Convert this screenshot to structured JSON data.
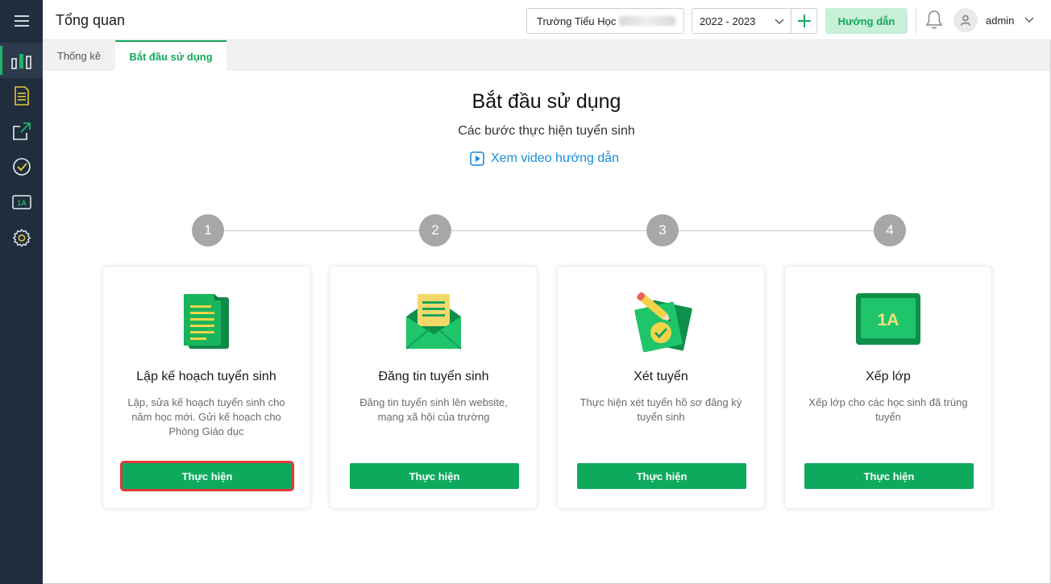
{
  "header": {
    "title": "Tổng quan",
    "school_name": "Trường Tiểu Học",
    "school_year": "2022 - 2023",
    "guide_label": "Hướng dẫn",
    "user_name": "admin"
  },
  "tabs": [
    {
      "label": "Thống kê"
    },
    {
      "label": "Bắt đầu sử dụng"
    }
  ],
  "main": {
    "title": "Bắt đầu sử dụng",
    "subtitle": "Các bước thực hiện tuyển sinh",
    "video_link": "Xem video hướng dẫn"
  },
  "steps": [
    {
      "number": "1",
      "title": "Lập kế hoạch tuyển sinh",
      "description": "Lập, sửa kế hoạch tuyển sinh cho năm học mới. Gửi kế hoạch cho Phòng Giáo dục",
      "button": "Thực hiện",
      "icon": "document-icon"
    },
    {
      "number": "2",
      "title": "Đăng tin tuyển sinh",
      "description": "Đăng tin tuyển sinh lên website, mạng xã hội của trường",
      "button": "Thực hiện",
      "icon": "envelope-icon"
    },
    {
      "number": "3",
      "title": "Xét tuyển",
      "description": "Thực hiện xét tuyển hồ sơ đăng ký tuyển sinh",
      "button": "Thực hiện",
      "icon": "checklist-pencil-icon"
    },
    {
      "number": "4",
      "title": "Xếp lớp",
      "description": "Xếp lớp cho các học sinh đã trúng tuyển",
      "button": "Thực hiện",
      "icon": "class-board-icon",
      "icon_text": "1A"
    }
  ],
  "sidebar": {
    "items": [
      {
        "icon": "menu-icon"
      },
      {
        "icon": "dashboard-chart-icon"
      },
      {
        "icon": "plan-document-icon"
      },
      {
        "icon": "post-arrow-icon"
      },
      {
        "icon": "check-circle-icon"
      },
      {
        "icon": "class-1a-icon",
        "label": "1A"
      },
      {
        "icon": "settings-gear-icon"
      }
    ]
  },
  "colors": {
    "sidebar_bg": "#1f2d3d",
    "accent_green": "#0daa5d",
    "guide_bg": "#c8efd8",
    "link_blue": "#1a8cd8",
    "highlight_red": "#e03a3a"
  }
}
